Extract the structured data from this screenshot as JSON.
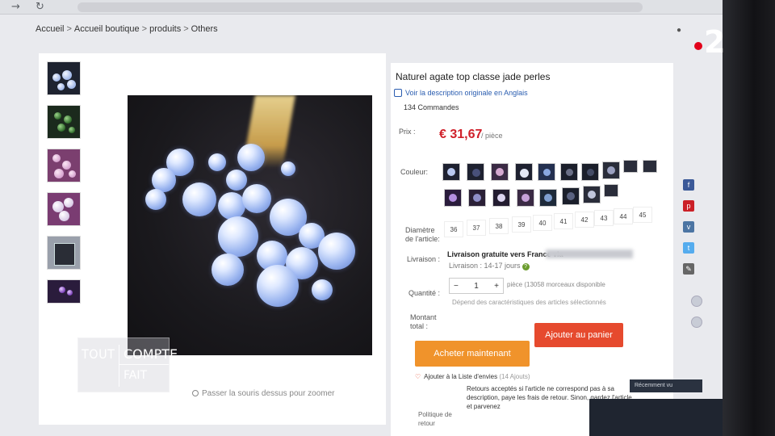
{
  "browser": {
    "forward_icon": "arrow-right-icon",
    "reload_icon": "reload-icon",
    "lock_icon": "lock-icon"
  },
  "breadcrumb": [
    "Accueil",
    "Accueil boutique",
    "produits",
    "Others"
  ],
  "breadcrumb_sep": ">",
  "product": {
    "title": "Naturel agate top classe jade perles",
    "translate_link": "Voir la description originale en Anglais",
    "orders": "134 Commandes",
    "price_label": "Prix :",
    "price": "€ 31,67",
    "price_unit": "/ pièce",
    "color_label": "Couleur:",
    "diameter_label": "Diamètre de l'article:",
    "sizes": [
      "36",
      "37",
      "38",
      "39",
      "40",
      "41",
      "42",
      "43",
      "44",
      "45"
    ],
    "delivery_label": "Livraison :",
    "delivery_title": "Livraison gratuite vers France via",
    "delivery_days": "Livraison : 14-17 jours",
    "quantity_label": "Quantité :",
    "quantity_value": "1",
    "quantity_minus": "−",
    "quantity_plus": "+",
    "quantity_available": "pièce (13058 morceaux disponible",
    "total_label": "Montant total :",
    "total_note": "Dépend des caractéristiques des articles sélectionnés",
    "buy_now": "Acheter maintenant",
    "add_to_cart": "Ajouter au panier",
    "wishlist": "Ajouter à la Liste d'envies",
    "wishlist_count": "(14 Ajouts)",
    "returns_label": "Politique de retour",
    "returns_text": "Retours acceptés si l'article ne correspond pas à sa description, paye les frais de retour. Sinon, gardez l'article et parvenez",
    "zoom_hint": "Passer la souris dessus pour zoomer"
  },
  "watermark": {
    "tout": "TOUT",
    "compte": "COMPTE",
    "fait": "FAIT"
  },
  "channel_logo": "2",
  "notification": "Récemment vu",
  "colors": {
    "price": "#d0202a",
    "buy_button": "#f0932b",
    "cart_button": "#e64a2e",
    "logo_dot": "#e2001a"
  }
}
